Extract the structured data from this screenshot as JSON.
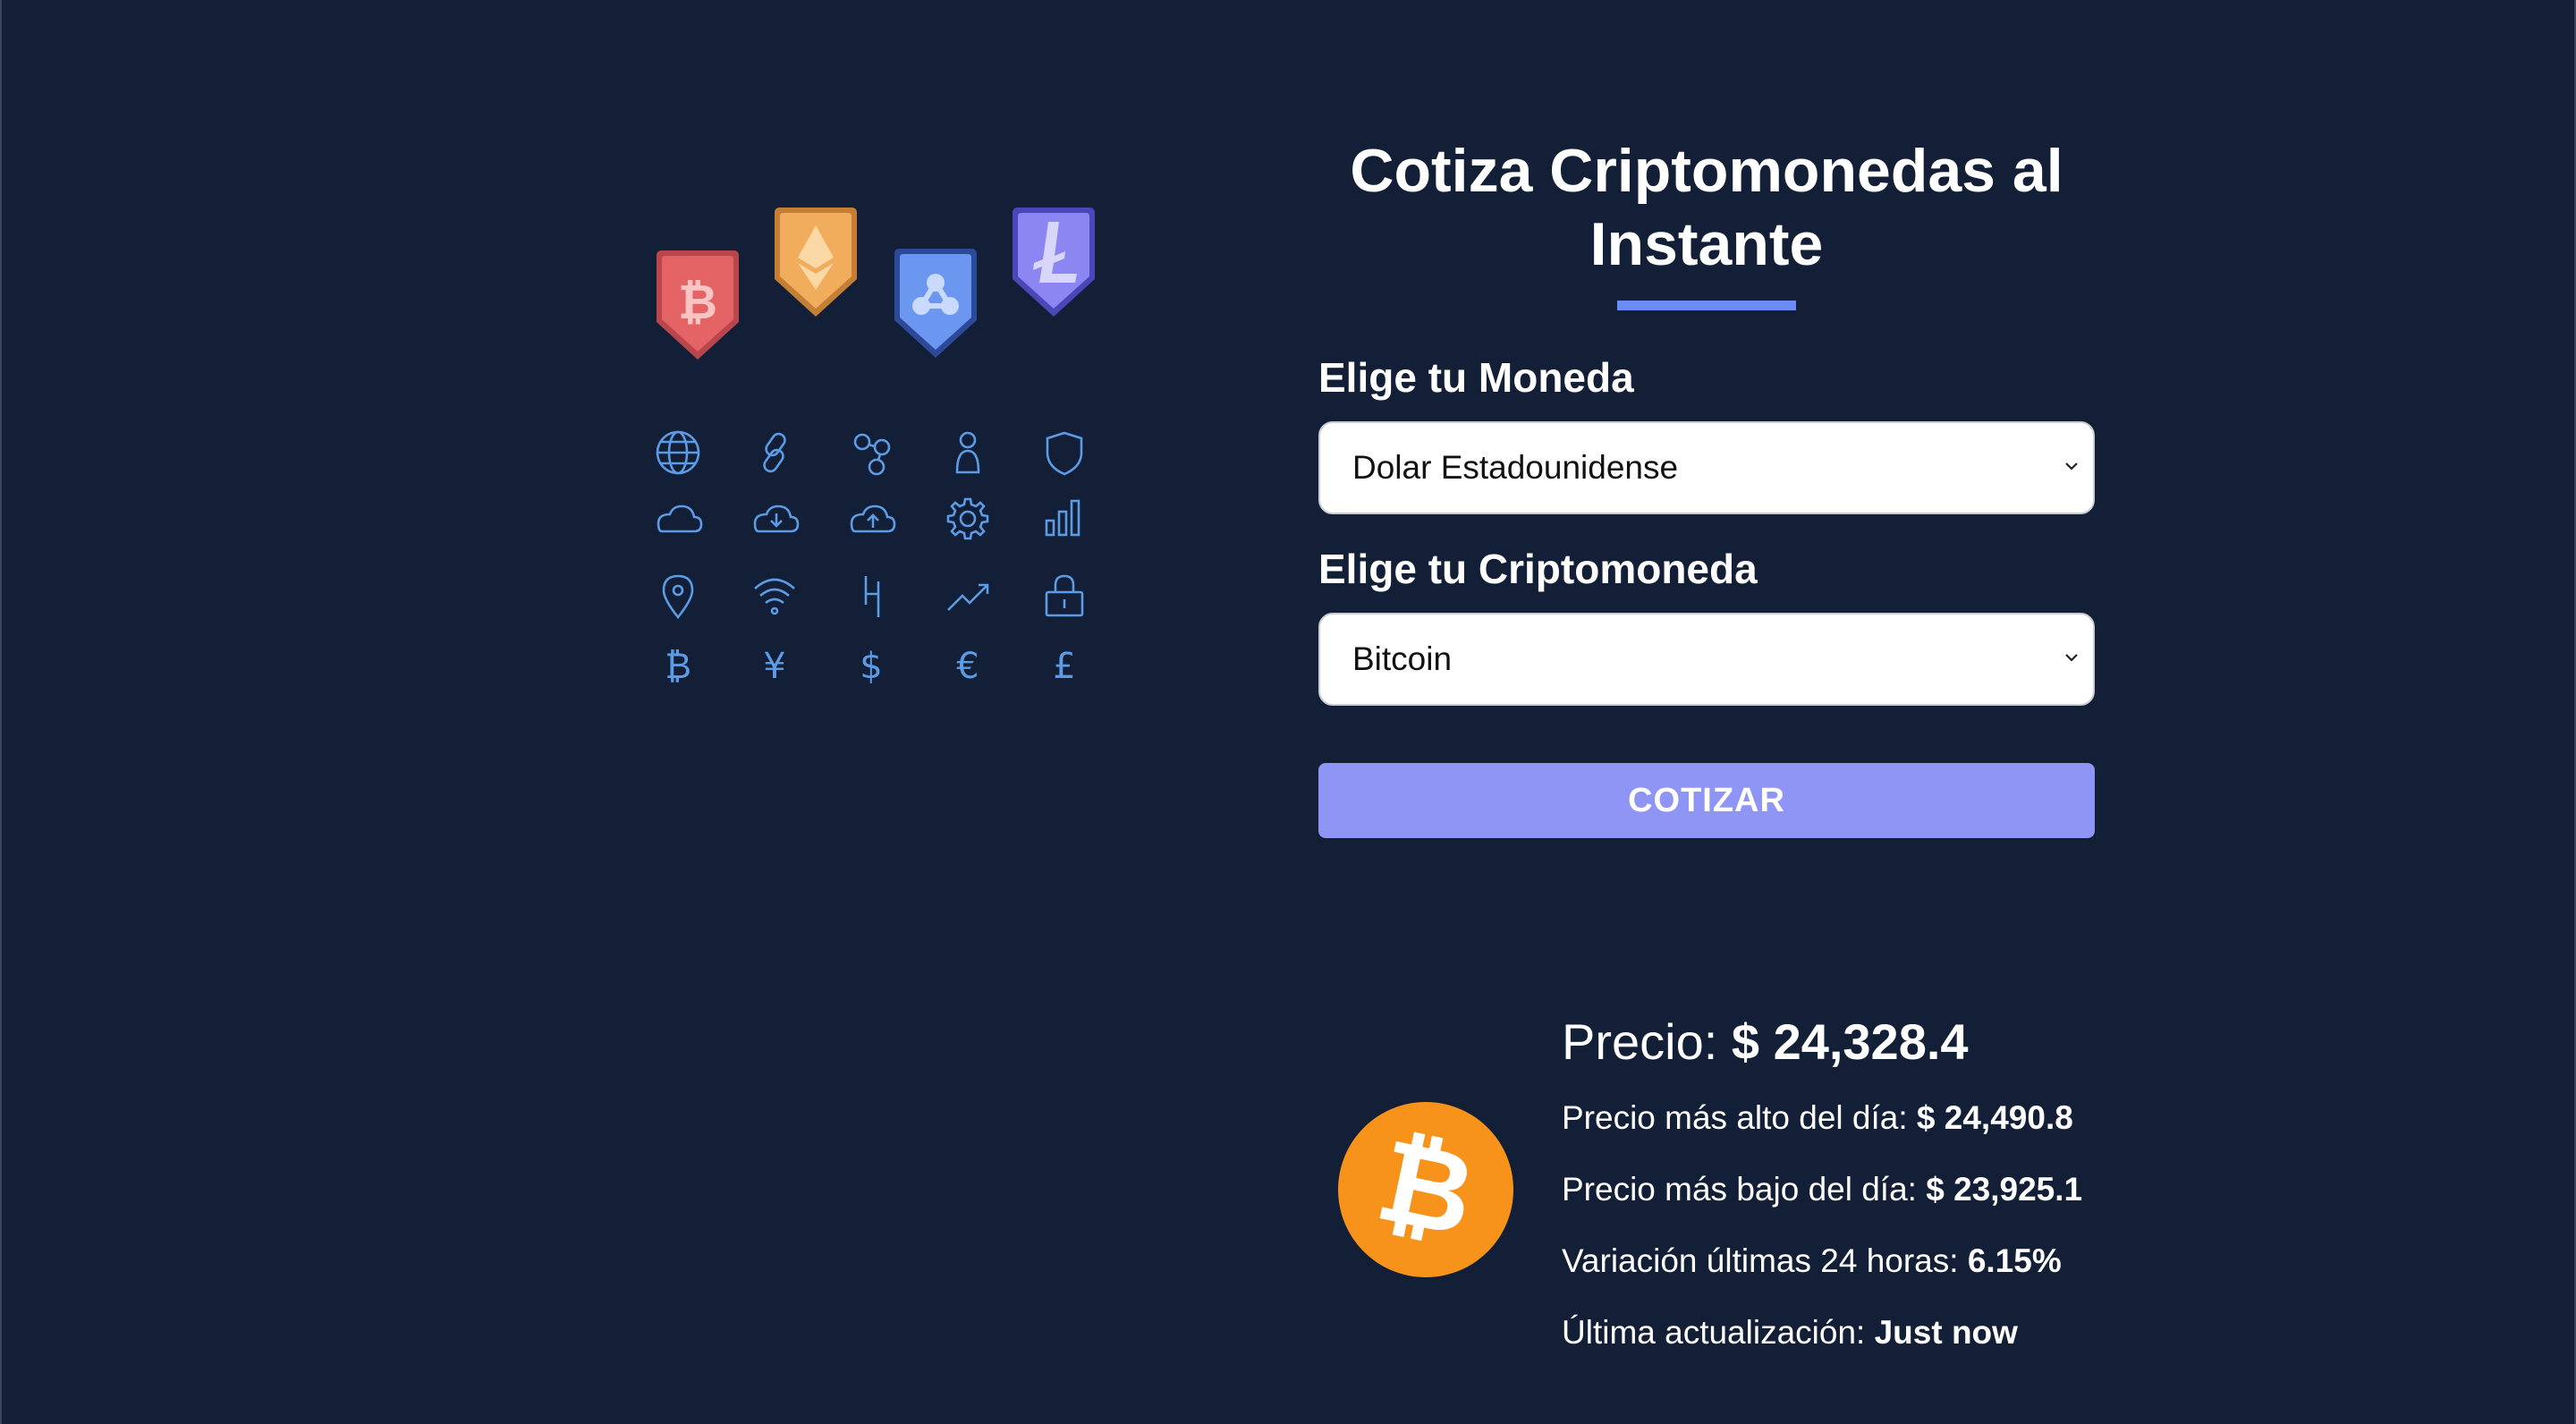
{
  "header": {
    "title": "Cotiza Criptomonedas al Instante"
  },
  "form": {
    "currency_label": "Elige tu Moneda",
    "currency_selected": "Dolar Estadounidense",
    "crypto_label": "Elige tu Criptomoneda",
    "crypto_selected": "Bitcoin",
    "submit_label": "COTIZAR"
  },
  "result": {
    "price_label": "Precio: ",
    "price_value": "$ 24,328.4",
    "high_label": "Precio más alto del día: ",
    "high_value": "$ 24,490.8",
    "low_label": "Precio más bajo del día: ",
    "low_value": "$ 23,925.1",
    "change_label": "Variación últimas 24 horas: ",
    "change_value": "6.15%",
    "updated_label": "Última actualización: ",
    "updated_value": "Just now",
    "coin_icon": "bitcoin-icon"
  },
  "illustration": {
    "badges": [
      "bitcoin-badge",
      "ethereum-badge",
      "ripple-badge",
      "litecoin-badge"
    ],
    "grid_icons": [
      "globe-icon",
      "link-icon",
      "nodes-icon",
      "user-icon",
      "shield-icon",
      "cloud-icon",
      "cloud-download-icon",
      "cloud-upload-icon",
      "gear-icon",
      "bar-chart-icon",
      "location-pin-icon",
      "wifi-icon",
      "fork-icon",
      "trend-up-icon",
      "lock-icon",
      "bitcoin-icon",
      "yen-icon",
      "dollar-icon",
      "euro-icon",
      "pound-icon"
    ]
  },
  "colors": {
    "background": "#121f36",
    "accent": "#6b8cf5",
    "button": "#8e95f5",
    "bitcoin": "#f7931a",
    "icon_stroke": "#5c9ce6"
  }
}
